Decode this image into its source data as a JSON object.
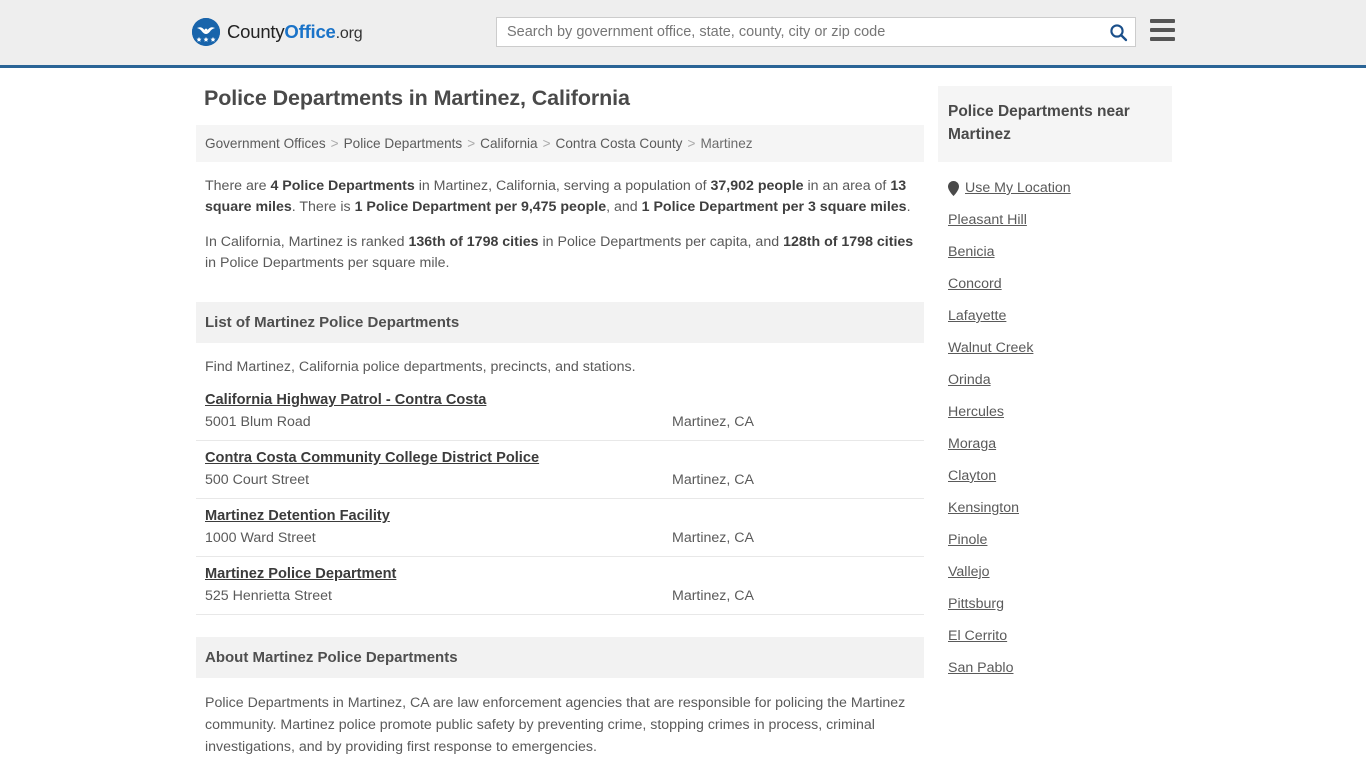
{
  "header": {
    "logo_text_part1": "County",
    "logo_text_part2": "Office",
    "logo_text_part3": ".org",
    "logo_icon": "eagle-shield-logo",
    "search_placeholder": "Search by government office, state, county, city or zip code",
    "search_value": "",
    "search_icon": "search-icon",
    "menu_icon": "hamburger-menu-icon",
    "accent_color": "#2a6496",
    "logo_blue": "#1a73c8"
  },
  "page_title": "Police Departments in Martinez, California",
  "breadcrumb": {
    "items": [
      {
        "label": "Government Offices"
      },
      {
        "label": "Police Departments"
      },
      {
        "label": "California"
      },
      {
        "label": "Contra Costa County"
      },
      {
        "label": "Martinez"
      }
    ],
    "separator": ">"
  },
  "stats": {
    "paragraph1": {
      "t1": "There are ",
      "b1": "4 Police Departments",
      "t2": " in Martinez, California, serving a population of ",
      "b2": "37,902 people",
      "t3": " in an area of ",
      "b3": "13 square miles",
      "t4": ". There is ",
      "b4": "1 Police Department per 9,475 people",
      "t5": ", and ",
      "b5": "1 Police Department per 3 square miles",
      "t6": "."
    },
    "paragraph2": {
      "t1": "In California, Martinez is ranked ",
      "b1": "136th of 1798 cities",
      "t2": " in Police Departments per capita, and ",
      "b2": "128th of 1798 cities",
      "t3": " in Police Departments per square mile."
    }
  },
  "list_section": {
    "heading": "List of Martinez Police Departments",
    "description": "Find Martinez, California police departments, precincts, and stations.",
    "items": [
      {
        "name": "California Highway Patrol - Contra Costa",
        "address": "5001 Blum Road",
        "city": "Martinez, CA"
      },
      {
        "name": "Contra Costa Community College District Police",
        "address": "500 Court Street",
        "city": "Martinez, CA"
      },
      {
        "name": "Martinez Detention Facility",
        "address": "1000 Ward Street",
        "city": "Martinez, CA"
      },
      {
        "name": "Martinez Police Department",
        "address": "525 Henrietta Street",
        "city": "Martinez, CA"
      }
    ]
  },
  "about_section": {
    "heading": "About Martinez Police Departments",
    "body": "Police Departments in Martinez, CA are law enforcement agencies that are responsible for policing the Martinez community. Martinez police promote public safety by preventing crime, stopping crimes in process, criminal investigations, and by providing first response to emergencies."
  },
  "sidebar": {
    "heading": "Police Departments near Martinez",
    "use_my_location": {
      "label": "Use My Location",
      "icon": "map-pin-icon"
    },
    "cities": [
      {
        "label": "Pleasant Hill"
      },
      {
        "label": "Benicia"
      },
      {
        "label": "Concord"
      },
      {
        "label": "Lafayette"
      },
      {
        "label": "Walnut Creek"
      },
      {
        "label": "Orinda"
      },
      {
        "label": "Hercules"
      },
      {
        "label": "Moraga"
      },
      {
        "label": "Clayton"
      },
      {
        "label": "Kensington"
      },
      {
        "label": "Pinole"
      },
      {
        "label": "Vallejo"
      },
      {
        "label": "Pittsburg"
      },
      {
        "label": "El Cerrito"
      },
      {
        "label": "San Pablo"
      }
    ]
  }
}
